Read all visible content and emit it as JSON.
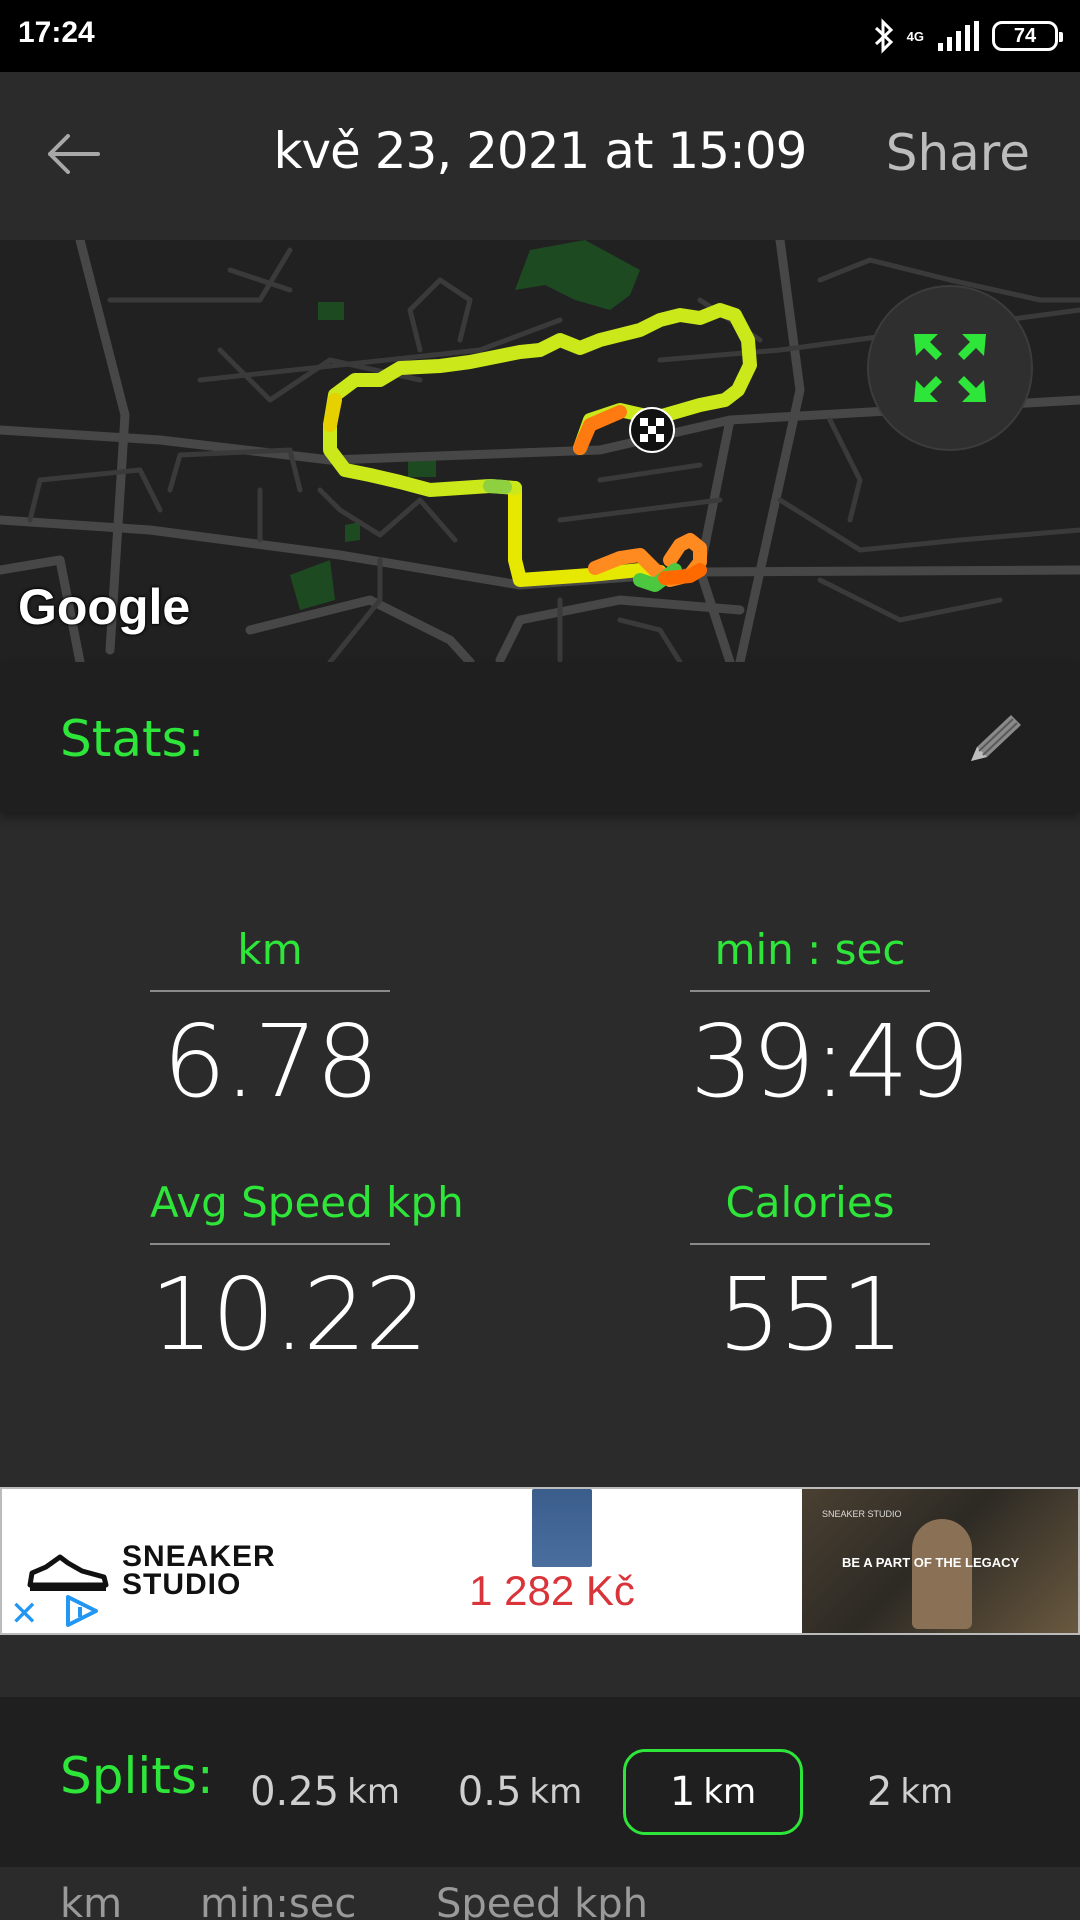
{
  "status_bar": {
    "time": "17:24",
    "network": "4G",
    "battery": "74"
  },
  "header": {
    "title": "kvě 23, 2021 at 15:09",
    "share_label": "Share"
  },
  "map": {
    "attribution": "Google",
    "route_colors": [
      "#d8f000",
      "#f0a000",
      "#ff6a00",
      "#3cc84a"
    ],
    "accent": "#2ee53a"
  },
  "stats": {
    "title": "Stats:",
    "distance": {
      "label": "km",
      "value": "6.78"
    },
    "time": {
      "label": "min : sec",
      "value": "39:49"
    },
    "speed": {
      "label": "Avg Speed kph",
      "value": "10.22"
    },
    "calories": {
      "label": "Calories",
      "value": "551"
    }
  },
  "ad": {
    "brand_line1": "SNEAKER",
    "brand_line2": "STUDIO",
    "price": "1 282 Kč",
    "tagline": "BE A PART OF THE LEGACY",
    "image_brand": "SNEAKER STUDIO"
  },
  "splits": {
    "title": "Splits:",
    "options": [
      {
        "value": "0.25",
        "unit": "km",
        "selected": false
      },
      {
        "value": "0.5",
        "unit": "km",
        "selected": false
      },
      {
        "value": "1",
        "unit": "km",
        "selected": true
      },
      {
        "value": "2",
        "unit": "km",
        "selected": false
      }
    ],
    "columns": [
      "km",
      "min:sec",
      "Speed kph"
    ]
  },
  "colors": {
    "accent_green": "#2ee53a",
    "background": "#2b2b2b",
    "panel": "#1f1f1f"
  }
}
